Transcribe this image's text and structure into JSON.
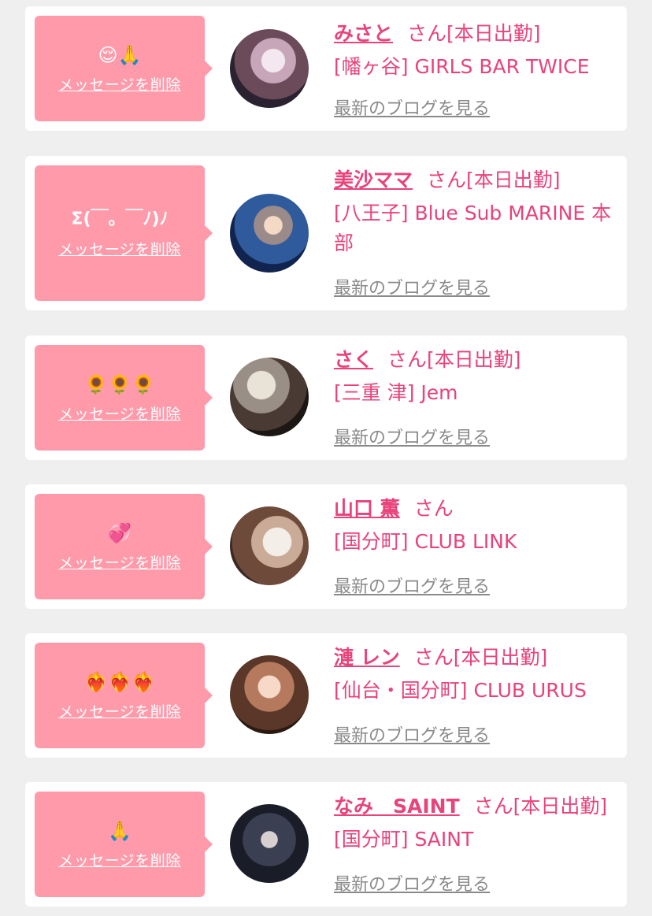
{
  "delete_label": "メッセージを削除",
  "blog_label": "最新のブログを見る",
  "colors": {
    "accent": "#e8437a",
    "bubble": "#ff9aaa",
    "background": "#efefef"
  },
  "cards": [
    {
      "message": "😌🙏",
      "name": "みさと",
      "suffix": "さん[本日出勤]",
      "shop": "[幡ヶ谷] GIRLS BAR TWICE",
      "avatar": "avatar-photo"
    },
    {
      "message": "Σ(￣。￣ﾉ)ﾉ",
      "name": "美沙ママ",
      "suffix": "さん[本日出勤]",
      "shop": "[八王子] Blue Sub MARINE 本部",
      "avatar": "avatar-photo"
    },
    {
      "message": "🌻🌻🌻",
      "name": "さく",
      "suffix": "さん[本日出勤]",
      "shop": "[三重 津] Jem",
      "avatar": "avatar-photo"
    },
    {
      "message": "💞",
      "name": "山口 薫",
      "suffix": "さん",
      "shop": "[国分町] CLUB LINK",
      "avatar": "avatar-photo"
    },
    {
      "message": "❤️‍🔥❤️‍🔥❤️‍🔥",
      "name": "漣 レン",
      "suffix": "さん[本日出勤]",
      "shop": "[仙台・国分町] CLUB URUS",
      "avatar": "avatar-photo"
    },
    {
      "message": "🙏",
      "name": "なみ　SAINT",
      "suffix": "さん[本日出勤]",
      "shop": "[国分町] SAINT",
      "avatar": "avatar-photo"
    }
  ]
}
